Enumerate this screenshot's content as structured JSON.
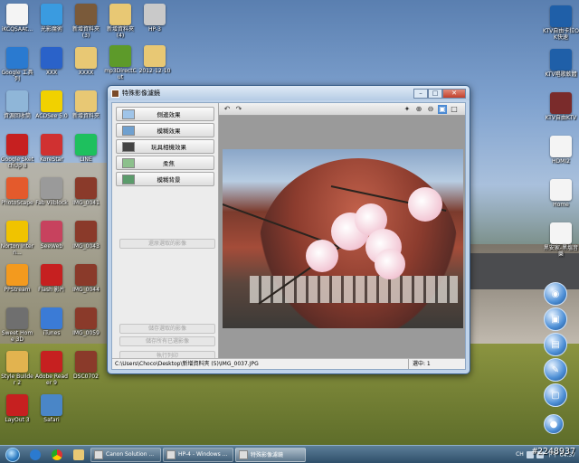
{
  "desktop_icons_left": [
    {
      "label": "iKCQSAAt...",
      "color": "#f4f4f4",
      "glyph": "doc-icon"
    },
    {
      "label": "Google 工具列",
      "color": "#2a7ad0",
      "glyph": "chrome-icon"
    },
    {
      "label": "資源回收筒",
      "color": "#8fb6d8",
      "glyph": "recycle-bin-icon"
    },
    {
      "label": "Google SketchUp 8",
      "color": "#c62020",
      "glyph": "sketchup-icon"
    },
    {
      "label": "PhotoScape",
      "color": "#e45a2c",
      "glyph": "photoscape-icon"
    },
    {
      "label": "Norton Intern...",
      "color": "#f0c300",
      "glyph": "norton-icon"
    },
    {
      "label": "PPStream",
      "color": "#f39a1e",
      "glyph": "ppstream-icon"
    },
    {
      "label": "Sweet Home 3D",
      "color": "#6f6f6f",
      "glyph": "sweethome-icon"
    },
    {
      "label": "Style Builder 2",
      "color": "#e2b34f",
      "glyph": "stylebuilder-icon"
    },
    {
      "label": "LayOut 3",
      "color": "#c62020",
      "glyph": "layout-icon"
    }
  ],
  "desktop_icons_col2": [
    {
      "label": "光影魔術",
      "color": "#3a9be0",
      "glyph": "photo-magic-icon"
    },
    {
      "label": "XXX",
      "color": "#2a62c9",
      "glyph": "app-icon"
    },
    {
      "label": "ACDSee 5.0",
      "color": "#f1d100",
      "glyph": "acdsee-icon"
    },
    {
      "label": "KoreStar",
      "color": "#d03131",
      "glyph": "korestar-icon"
    },
    {
      "label": "Fab Vilblock",
      "color": "#9a9a9a",
      "glyph": "speaker-icon"
    },
    {
      "label": "SeeWeb",
      "color": "#c7425e",
      "glyph": "seeweb-icon"
    },
    {
      "label": "Flash 影片",
      "color": "#c62020",
      "glyph": "flash-icon"
    },
    {
      "label": "iTunes",
      "color": "#3b7bd6",
      "glyph": "itunes-icon"
    },
    {
      "label": "Adobe Reader 9",
      "color": "#c62020",
      "glyph": "adobe-reader-icon"
    },
    {
      "label": "Safari",
      "color": "#4a86c7",
      "glyph": "safari-icon"
    }
  ],
  "desktop_icons_col3": [
    {
      "label": "新增資料夾(3)",
      "color": "#7a5a3a",
      "glyph": "folder-icon"
    },
    {
      "label": "XXXX",
      "color": "#e8c874",
      "glyph": "folder-icon"
    },
    {
      "label": "新增資料夾",
      "color": "#e8c874",
      "glyph": "folder-icon"
    },
    {
      "label": "LINE",
      "color": "#1ec05e",
      "glyph": "line-icon"
    },
    {
      "label": "IMG_0041",
      "color": "#8a3a2a",
      "glyph": "image-icon"
    },
    {
      "label": "IMG_0043",
      "color": "#8a3a2a",
      "glyph": "image-icon"
    },
    {
      "label": "IMG_0044",
      "color": "#8a3a2a",
      "glyph": "image-icon"
    },
    {
      "label": "IMG_0059",
      "color": "#8a3a2a",
      "glyph": "image-icon"
    },
    {
      "label": "DSC0702",
      "color": "#8a3a2a",
      "glyph": "image-icon"
    }
  ],
  "desktop_icons_top_extra": [
    {
      "label": "新增資料夾(4)",
      "color": "#e8c874",
      "glyph": "folder-icon"
    },
    {
      "label": "HP-3",
      "color": "#c9c9c9",
      "glyph": "hp-icon"
    },
    {
      "label": "mp3DirectCut",
      "color": "#5d9a2a",
      "glyph": "mp3-icon"
    },
    {
      "label": "2012-12-10",
      "color": "#e8c874",
      "glyph": "folder-icon"
    }
  ],
  "desktop_icons_right": [
    {
      "label": "KTV自由卡拉OK快速",
      "color": "#1f5fa8",
      "glyph": "ktv-icon"
    },
    {
      "label": "KTV唱歌軟體",
      "color": "#1f5fa8",
      "glyph": "ktv-icon"
    },
    {
      "label": "KTV自由KTV",
      "color": "#7a2b2b",
      "glyph": "ktv-icon"
    },
    {
      "label": "HDMI2",
      "color": "#f4f4f4",
      "glyph": "doc-icon"
    },
    {
      "label": "Home",
      "color": "#f4f4f4",
      "glyph": "doc-icon"
    },
    {
      "label": "黑安家-黑塩音樂",
      "color": "#f4f4f4",
      "glyph": "music-file-icon"
    }
  ],
  "window": {
    "title": "特殊影像濾鏡",
    "buttons": {
      "min": "–",
      "max": "□",
      "close": "✕"
    },
    "functions": [
      {
        "label": "側邊效果",
        "name": "side-effect-button"
      },
      {
        "label": "模糊效果",
        "name": "blur-effect-button"
      },
      {
        "label": "玩具相機效果",
        "name": "toy-camera-button"
      },
      {
        "label": "柔焦",
        "name": "soft-focus-button"
      },
      {
        "label": "模糊背景",
        "name": "blur-background-button"
      }
    ],
    "disabled_buttons": [
      "還原選取的影像",
      "儲存選取的影像",
      "儲存所有已選影像",
      "執行列印"
    ],
    "status": {
      "path": "C:\\Users\\Choco\\Desktop\\新增資料夾 (5)\\IMG_0037.JPG",
      "count": "選中: 1"
    }
  },
  "taskbar": {
    "tasks": [
      {
        "label": "Canon Solution ...",
        "active": false
      },
      {
        "label": "HP-4 - Windows ...",
        "active": false
      },
      {
        "label": "特殊影像濾鏡",
        "active": true
      }
    ],
    "tray": {
      "lang": "CH",
      "time": "下午 04:57"
    }
  },
  "watermark": "#2248937"
}
